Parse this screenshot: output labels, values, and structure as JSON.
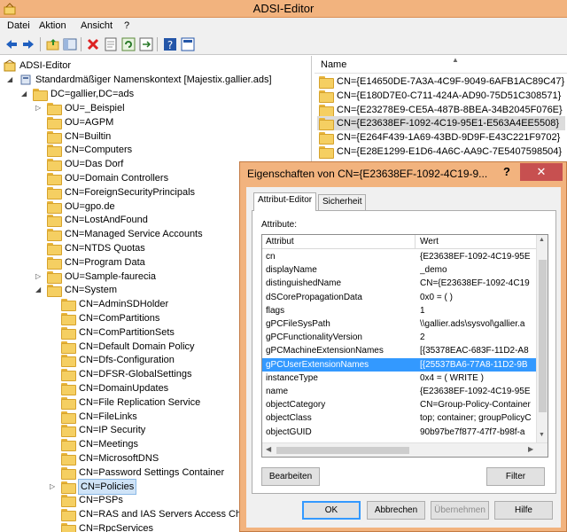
{
  "window": {
    "title": "ADSI-Editor"
  },
  "menu": [
    "Datei",
    "Aktion",
    "Ansicht",
    "?"
  ],
  "toolbar_icons": [
    "back-arrow-icon",
    "forward-arrow-icon",
    "up-folder-icon",
    "console-tree-icon",
    "delete-icon",
    "properties-icon",
    "refresh-icon",
    "export-icon",
    "help-icon",
    "mmc-icon"
  ],
  "tree": {
    "root": "ADSI-Editor",
    "context": "Standardmäßiger Namenskontext [Majestix.gallier.ads]",
    "domain": "DC=gallier,DC=ads",
    "items": [
      "OU=_Beispiel",
      "OU=AGPM",
      "CN=Builtin",
      "CN=Computers",
      "OU=Das Dorf",
      "OU=Domain Controllers",
      "CN=ForeignSecurityPrincipals",
      "OU=gpo.de",
      "CN=LostAndFound",
      "CN=Managed Service Accounts",
      "CN=NTDS Quotas",
      "CN=Program Data",
      "OU=Sample-faurecia",
      "CN=System"
    ],
    "system_items": [
      "CN=AdminSDHolder",
      "CN=ComPartitions",
      "CN=ComPartitionSets",
      "CN=Default Domain Policy",
      "CN=Dfs-Configuration",
      "CN=DFSR-GlobalSettings",
      "CN=DomainUpdates",
      "CN=File Replication Service",
      "CN=FileLinks",
      "CN=IP Security",
      "CN=Meetings",
      "CN=MicrosoftDNS",
      "CN=Password Settings Container",
      "CN=Policies",
      "CN=PSPs",
      "CN=RAS and IAS Servers Access Check",
      "CN=RpcServices"
    ]
  },
  "list": {
    "header": "Name",
    "items": [
      "CN={E14650DE-7A3A-4C9F-9049-6AFB1AC89C47}",
      "CN={E180D7E0-C711-424A-AD90-75D51C308571}",
      "CN={E23278E9-CE5A-487B-8BEA-34B2045F076E}",
      "CN={E23638EF-1092-4C19-95E1-E563A4EE5508}",
      "CN={E264F439-1A69-43BD-9D9F-E43C221F9702}",
      "CN={E28E1299-E1D6-4A6C-AA9C-7E5407598504}"
    ]
  },
  "dialog": {
    "title": "Eigenschaften von CN={E23638EF-1092-4C19-9...",
    "help": "?",
    "close": "✕",
    "tabs": [
      "Attribut-Editor",
      "Sicherheit"
    ],
    "attributes_label": "Attribute:",
    "col_attr": "Attribut",
    "col_value": "Wert",
    "rows": [
      {
        "a": "cn",
        "v": "{E23638EF-1092-4C19-95E"
      },
      {
        "a": "displayName",
        "v": "_demo"
      },
      {
        "a": "distinguishedName",
        "v": "CN={E23638EF-1092-4C19"
      },
      {
        "a": "dSCorePropagationData",
        "v": "0x0 = ( )"
      },
      {
        "a": "flags",
        "v": "1"
      },
      {
        "a": "gPCFileSysPath",
        "v": "\\\\gallier.ads\\sysvol\\gallier.a"
      },
      {
        "a": "gPCFunctionalityVersion",
        "v": "2"
      },
      {
        "a": "gPCMachineExtensionNames",
        "v": "[{35378EAC-683F-11D2-A8"
      },
      {
        "a": "gPCUserExtensionNames",
        "v": "[{25537BA6-77A8-11D2-9B"
      },
      {
        "a": "instanceType",
        "v": "0x4 = ( WRITE )"
      },
      {
        "a": "name",
        "v": "{E23638EF-1092-4C19-95E"
      },
      {
        "a": "objectCategory",
        "v": "CN=Group-Policy-Container"
      },
      {
        "a": "objectClass",
        "v": "top; container; groupPolicyC"
      },
      {
        "a": "objectGUID",
        "v": "90b97be7f877-47f7-b98f-a"
      }
    ],
    "edit_button": "Bearbeiten",
    "filter_button": "Filter",
    "ok": "OK",
    "cancel": "Abbrechen",
    "apply": "Übernehmen",
    "help_button": "Hilfe"
  }
}
